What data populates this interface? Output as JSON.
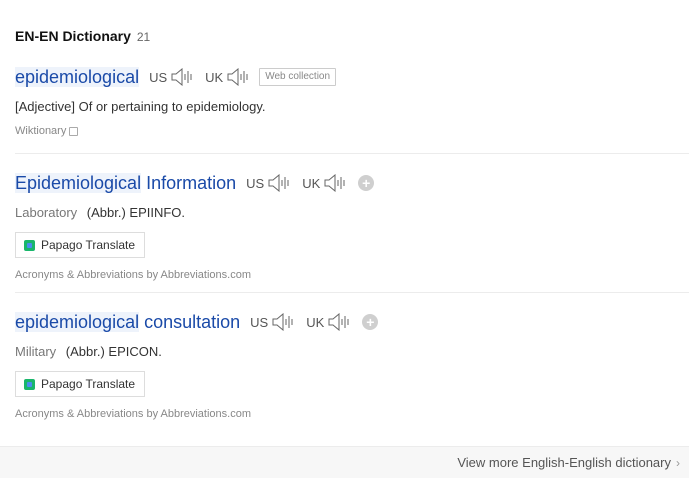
{
  "section": {
    "title": "EN-EN Dictionary",
    "count": "21"
  },
  "entries": [
    {
      "word_highlight": "epidemiological",
      "word_rest": "",
      "pron_us": "US",
      "pron_uk": "UK",
      "tag": "Web collection",
      "definition_prefix": "[Adjective]",
      "definition": "Of or pertaining to epidemiology.",
      "source": "Wiktionary"
    },
    {
      "word_highlight": "Epidemiological",
      "word_rest": " Information",
      "pron_us": "US",
      "pron_uk": "UK",
      "category": "Laboratory",
      "definition": "(Abbr.) EPIINFO.",
      "translate_label": "Papago Translate",
      "source": "Acronyms & Abbreviations by Abbreviations.com"
    },
    {
      "word_highlight": "epidemiological",
      "word_rest": " consultation",
      "pron_us": "US",
      "pron_uk": "UK",
      "category": "Military",
      "definition": "(Abbr.) EPICON.",
      "translate_label": "Papago Translate",
      "source": "Acronyms & Abbreviations by Abbreviations.com"
    }
  ],
  "footer": {
    "more_label": "View more English-English dictionary"
  },
  "icons": {
    "speaker": "speaker-icon",
    "plus": "plus-icon",
    "papago": "papago-icon",
    "chevron": "chevron-right-icon",
    "checkbox": "checkbox-icon"
  },
  "colors": {
    "link": "#1a4aa8",
    "highlight": "#eef3fb",
    "papago_green": "#19b66b"
  }
}
